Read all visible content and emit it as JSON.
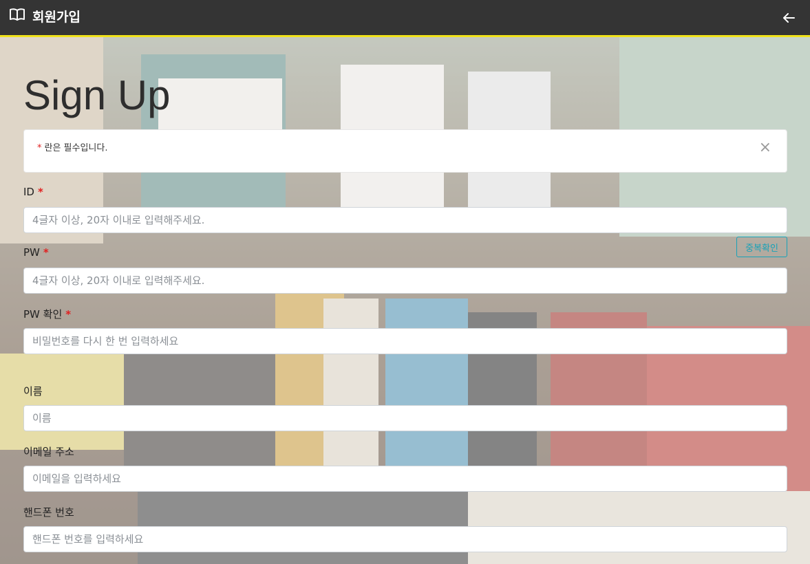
{
  "header": {
    "title": "회원가입",
    "accent_color": "#f0e21b",
    "background_color": "#343434",
    "brand_icon": "open-book-icon",
    "back_icon": "arrow-left-icon"
  },
  "page": {
    "title": "Sign Up"
  },
  "notice": {
    "required_mark": "*",
    "text": "란은 필수입니다.",
    "close_symbol": "×"
  },
  "form": {
    "id": {
      "label": "ID",
      "required": "*",
      "placeholder": "4글자 이상, 20자 이내로 입력해주세요.",
      "check_button": "중복확인"
    },
    "pw": {
      "label": "PW",
      "required": "*",
      "placeholder": "4글자 이상, 20자 이내로 입력해주세요."
    },
    "pw_confirm": {
      "label": "PW 확인",
      "required": "*",
      "placeholder": "비밀번호를 다시 한 번 입력하세요"
    },
    "name": {
      "label": "이름",
      "placeholder": "이름"
    },
    "email": {
      "label": "이메일 주소",
      "placeholder": "이메일을 입력하세요"
    },
    "phone": {
      "label": "핸드폰 번호",
      "placeholder": "핸드폰 번호를 입력하세요"
    }
  },
  "colors": {
    "required": "#e02020",
    "button_outline": "#17a2b8"
  }
}
